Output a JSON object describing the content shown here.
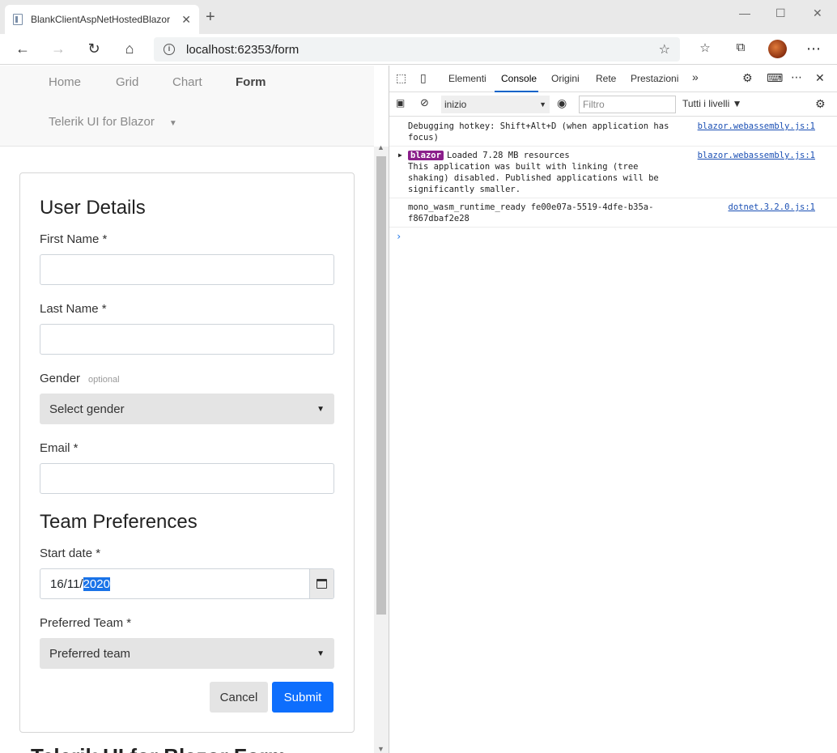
{
  "browser": {
    "tab_title": "BlankClientAspNetHostedBlazor",
    "tab_close": "✕",
    "new_tab": "+",
    "url": "localhost:62353/form",
    "win_min": "—",
    "win_max": "☐",
    "win_close": "✕"
  },
  "nav": {
    "items": [
      "Home",
      "Grid",
      "Chart",
      "Form"
    ],
    "active": "Form",
    "dropdown": "Telerik UI for Blazor"
  },
  "form": {
    "user_details_title": "User Details",
    "first_name_label": "First Name *",
    "last_name_label": "Last Name *",
    "gender_label": "Gender",
    "gender_optional": "optional",
    "gender_value": "Select gender",
    "email_label": "Email *",
    "team_prefs_title": "Team Preferences",
    "start_date_label": "Start date *",
    "start_date_prefix": "16/11/",
    "start_date_selected": "2020",
    "preferred_team_label": "Preferred Team *",
    "preferred_team_value": "Preferred team",
    "cancel_label": "Cancel",
    "submit_label": "Submit",
    "below_heading": "Telerik UI for Blazor Form"
  },
  "devtools": {
    "tabs": [
      "Elementi",
      "Console",
      "Origini",
      "Rete",
      "Prestazioni"
    ],
    "active_tab": "Console",
    "more": "»",
    "context": "inizio",
    "filter_placeholder": "Filtro",
    "levels": "Tutti i livelli ▼",
    "messages": [
      {
        "text": "Debugging hotkey: Shift+Alt+D (when application has focus)",
        "source": "blazor.webassembly.js:1"
      },
      {
        "badge": "blazor",
        "text": "Loaded 7.28 MB resources",
        "detail": "This application was built with linking (tree shaking) disabled. Published applications will be significantly smaller.",
        "source": "blazor.webassembly.js:1"
      },
      {
        "text": "mono_wasm_runtime_ready fe00e07a-5519-4dfe-b35a-f867dbaf2e28",
        "source": "dotnet.3.2.0.js:1"
      }
    ],
    "prompt": "›"
  }
}
